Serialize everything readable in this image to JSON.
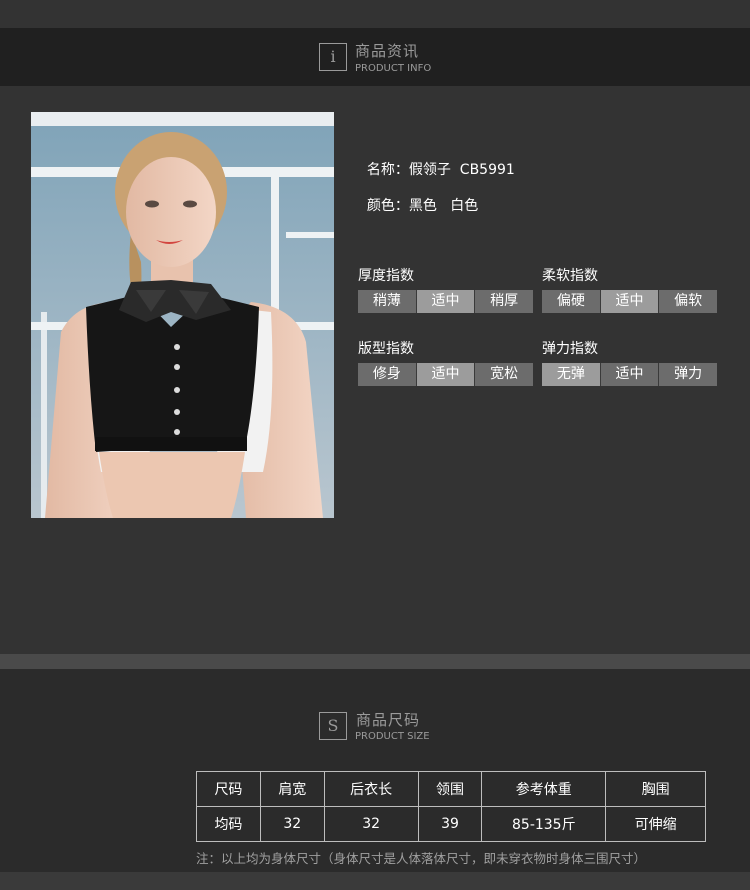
{
  "info_header": {
    "icon": "i",
    "title_cn": "商品资讯",
    "title_en": "PRODUCT INFO"
  },
  "product": {
    "name_label": "名称：",
    "name_value": "假领子  CB5991",
    "color_label": "颜色：",
    "color_value": "黑色   白色"
  },
  "indices": [
    {
      "title": "厚度指数",
      "options": [
        "稍薄",
        "适中",
        "稍厚"
      ],
      "selected": 1
    },
    {
      "title": "柔软指数",
      "options": [
        "偏硬",
        "适中",
        "偏软"
      ],
      "selected": 1
    },
    {
      "title": "版型指数",
      "options": [
        "修身",
        "适中",
        "宽松"
      ],
      "selected": 1
    },
    {
      "title": "弹力指数",
      "options": [
        "无弹",
        "适中",
        "弹力"
      ],
      "selected": 0
    }
  ],
  "size_header": {
    "icon": "S",
    "title_cn": "商品尺码",
    "title_en": "PRODUCT SIZE"
  },
  "size_table": {
    "headers": [
      "尺码",
      "肩宽",
      "后衣长",
      "领围",
      "参考体重",
      "胸围"
    ],
    "rows": [
      [
        "均码",
        "32",
        "32",
        "39",
        "85-135斤",
        "可伸缩"
      ]
    ]
  },
  "note": "注：以上均为身体尺寸（身体尺寸是人体落体尺寸，即未穿衣物时身体三围尺寸）"
}
